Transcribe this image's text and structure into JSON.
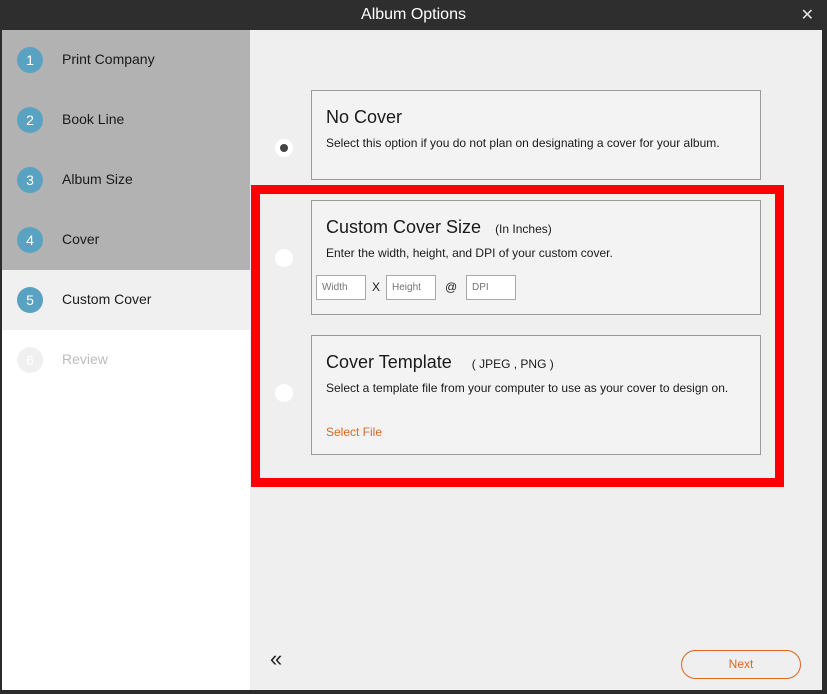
{
  "window": {
    "title": "Album Options",
    "close_glyph": "✕"
  },
  "sidebar": {
    "steps": [
      {
        "num": "1",
        "label": "Print Company",
        "state": "done"
      },
      {
        "num": "2",
        "label": "Book Line",
        "state": "done"
      },
      {
        "num": "3",
        "label": "Album Size",
        "state": "done"
      },
      {
        "num": "4",
        "label": "Cover",
        "state": "done"
      },
      {
        "num": "5",
        "label": "Custom Cover",
        "state": "active"
      },
      {
        "num": "6",
        "label": "Review",
        "state": "pending"
      }
    ]
  },
  "options": {
    "no_cover": {
      "title": "No Cover",
      "description": "Select this option if you do not plan on designating a cover for your album.",
      "selected": true
    },
    "custom_size": {
      "title": "Custom Cover Size",
      "subtitle": "(In Inches)",
      "description": "Enter the width, height, and DPI of your custom cover.",
      "width_placeholder": "Width",
      "height_placeholder": "Height",
      "dpi_placeholder": "DPI",
      "times": "X",
      "at": "@",
      "selected": false
    },
    "template": {
      "title": "Cover Template",
      "subtitle": "( JPEG , PNG )",
      "description": "Select a template file from your computer to use as your cover to design on.",
      "select_file": "Select File",
      "selected": false
    }
  },
  "footer": {
    "back_glyph": "«",
    "next_label": "Next"
  },
  "colors": {
    "accent": "#e0651e",
    "step_circle": "#5aa2c2",
    "highlight": "#ff0000"
  }
}
